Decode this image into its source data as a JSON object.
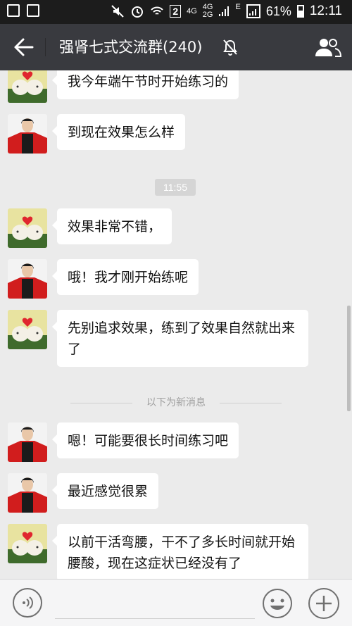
{
  "status_bar": {
    "sim_badge": "2",
    "net_top": "4G",
    "net_mid": "4G",
    "net_bottom": "2G",
    "edge": "E",
    "battery": "61%",
    "time": "12:11"
  },
  "header": {
    "title": "强肾七式交流群(240)"
  },
  "messages": [
    {
      "avatar": "hearts-avatar",
      "text": "我今年端午节时开始练习的"
    },
    {
      "avatar": "woman-red-avatar",
      "text": "到现在效果怎么样"
    },
    {
      "timestamp": "11:55"
    },
    {
      "avatar": "hearts-avatar",
      "text": "效果非常不错，"
    },
    {
      "avatar": "woman-red-avatar",
      "text": "哦！我才刚开始练呢"
    },
    {
      "avatar": "hearts-avatar",
      "text": "先别追求效果，练到了效果自然就出来了"
    },
    {
      "divider": "以下为新消息"
    },
    {
      "avatar": "woman-red-avatar",
      "text": "嗯！可能要很长时间练习吧"
    },
    {
      "avatar": "woman-red-avatar",
      "text": "最近感觉很累"
    },
    {
      "avatar": "hearts-avatar",
      "text": "以前干活弯腰，干不了多长时间就开始腰酸，现在这症状已经没有了"
    }
  ],
  "colors": {
    "status_bar": "#1c1c1c",
    "title_bar": "#393a3f",
    "chat_bg": "#ebebeb",
    "bubble": "#ffffff"
  }
}
